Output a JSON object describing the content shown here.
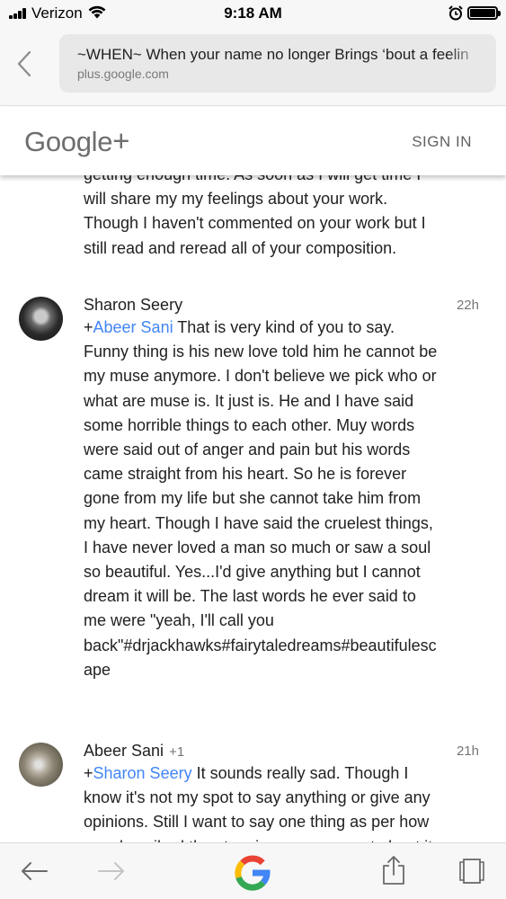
{
  "status_bar": {
    "carrier": "Verizon",
    "time": "9:18 AM"
  },
  "browser": {
    "page_title": "~WHEN~ When your name no longer Brings ‘bout a feelin",
    "domain": "plus.google.com"
  },
  "header": {
    "logo_text": "Google",
    "logo_plus": "+",
    "sign_in_label": "SIGN IN"
  },
  "partial_comment": {
    "text": "getting enough time. As soon as I will get time I will share my my feelings about your work. Though I haven't commented on your work but I still read and reread all of your composition."
  },
  "comments": [
    {
      "author": "Sharon Seery",
      "plus_ones": "",
      "time": "22h",
      "mention_prefix": "+",
      "mention": "Abeer Sani",
      "text": " That is very kind of you to say. Funny thing is his new love told him he cannot be my muse anymore. I don't believe we pick who or what are muse is. It just is. He and I have said some horrible things to each other. Muy words were said out of anger and pain but his words came straight from his heart. So he is forever gone from my life but she cannot take him from my heart. Though I have said the cruelest things, I have never loved a man so much or saw a soul so beautiful. Yes...I'd give anything but I cannot dream it will be. The last words he ever said to me were \"yeah, I'll call you back\"#drjackhawks#fairytaledreams#beautifulescape"
    },
    {
      "author": "Abeer Sani",
      "plus_ones": "+1",
      "time": "21h",
      "mention_prefix": "+",
      "mention": "Sharon Seery",
      "text": " It sounds really sad. Though I know it's not my spot to say anything or give any opinions. Still I want to say one thing as per how you described the story in your comment about it."
    }
  ],
  "toolbar": {
    "back_icon": "back-arrow-icon",
    "forward_icon": "forward-arrow-icon",
    "center_icon": "google-g-icon",
    "share_icon": "share-icon",
    "tabs_icon": "tabs-icon"
  },
  "colors": {
    "mention": "#4285f4",
    "bar_background": "#f7f7f7",
    "url_box": "#e8e8e8"
  }
}
